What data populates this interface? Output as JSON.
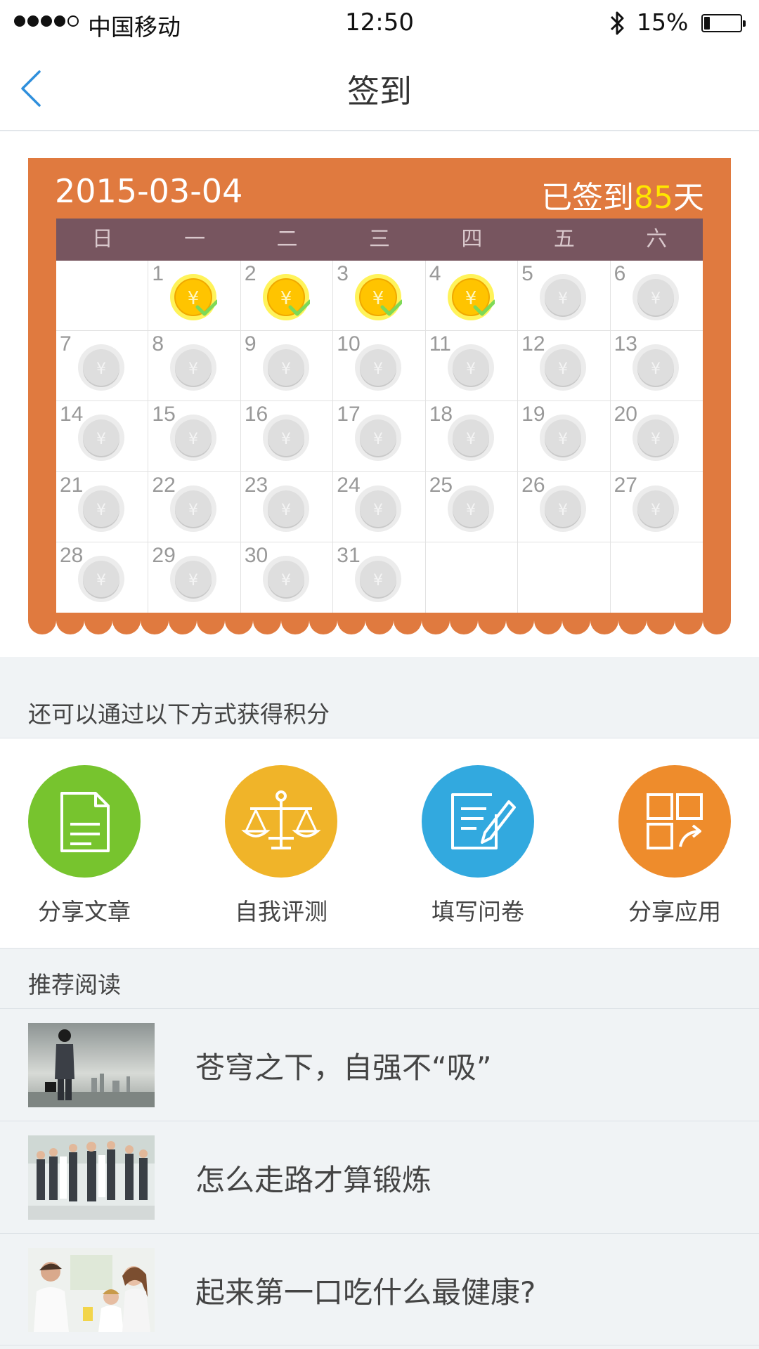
{
  "status_bar": {
    "carrier": "中国移动",
    "time": "12:50",
    "battery_text": "15%",
    "battery_level": 0.15,
    "signal_bars_filled": 4,
    "signal_bars_total": 5,
    "icons": [
      "signal-dots-icon",
      "bluetooth-icon",
      "battery-icon"
    ]
  },
  "nav": {
    "title": "签到",
    "back_icon": "chevron-left-icon"
  },
  "calendar": {
    "date": "2015-03-04",
    "signed_prefix": "已签到",
    "signed_days": "85",
    "signed_suffix": "天",
    "weekdays": [
      "日",
      "一",
      "二",
      "三",
      "四",
      "五",
      "六"
    ],
    "first_weekday_index": 1,
    "days_in_month": 31,
    "checked_days": [
      1,
      2,
      3,
      4
    ],
    "coin_symbol": "¥",
    "colors": {
      "card": "#e07a3f",
      "header": "#77555f",
      "gold": "#ffd200",
      "check": "#7ed957",
      "silver": "#dddddd",
      "signed_count": "#ffe600"
    }
  },
  "earn": {
    "label": "还可以通过以下方式获得积分",
    "items": [
      {
        "label": "分享文章",
        "icon": "document-icon",
        "color": "#77c42e"
      },
      {
        "label": "自我评测",
        "icon": "scale-icon",
        "color": "#f0b429"
      },
      {
        "label": "填写问卷",
        "icon": "edit-form-icon",
        "color": "#32a9df"
      },
      {
        "label": "分享应用",
        "icon": "share-app-icon",
        "color": "#ee8c2c"
      }
    ]
  },
  "recommend": {
    "label": "推荐阅读",
    "items": [
      {
        "title": "苍穹之下，自强不“吸”",
        "thumb": "gas-mask-businessman-image"
      },
      {
        "title": "怎么走路才算锻炼",
        "thumb": "walking-people-image"
      },
      {
        "title": "起来第一口吃什么最健康?",
        "thumb": "family-breakfast-image"
      }
    ]
  }
}
